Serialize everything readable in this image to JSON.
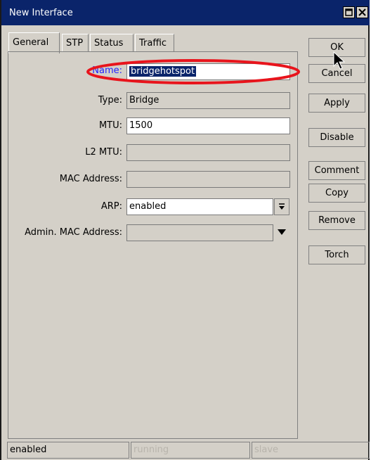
{
  "window": {
    "title": "New Interface",
    "controls": [
      "restore",
      "close"
    ]
  },
  "tabs": [
    "General",
    "STP",
    "Status",
    "Traffic"
  ],
  "form": {
    "name": {
      "label": "Name:",
      "value": "bridgehotspot"
    },
    "type": {
      "label": "Type:",
      "value": "Bridge"
    },
    "mtu": {
      "label": "MTU:",
      "value": "1500"
    },
    "l2mtu": {
      "label": "L2 MTU:",
      "value": ""
    },
    "mac": {
      "label": "MAC Address:",
      "value": ""
    },
    "arp": {
      "label": "ARP:",
      "value": "enabled"
    },
    "admin_mac": {
      "label": "Admin. MAC Address:",
      "value": ""
    }
  },
  "buttons": [
    "OK",
    "Cancel",
    "Apply",
    "Disable",
    "Comment",
    "Copy",
    "Remove",
    "Torch"
  ],
  "status": [
    "enabled",
    "running",
    "slave"
  ],
  "colors": {
    "titlebar": "#0a246a",
    "highlight_ellipse": "#e8141c"
  }
}
